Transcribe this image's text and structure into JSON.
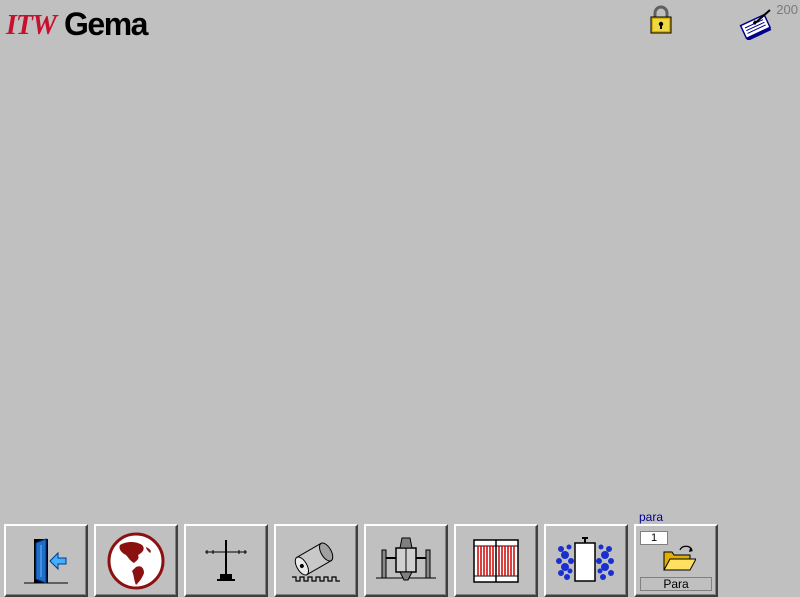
{
  "header": {
    "logo_itw": "ITW",
    "logo_gema": "Gema",
    "counter": "200"
  },
  "toolbar": {
    "para_caption": "para",
    "para_value": "1",
    "para_label": "Para",
    "buttons": [
      {
        "icon": "exit-door-icon"
      },
      {
        "icon": "globe-icon"
      },
      {
        "icon": "axis-icon"
      },
      {
        "icon": "roller-icon"
      },
      {
        "icon": "spray-booth-icon"
      },
      {
        "icon": "filter-grid-icon"
      },
      {
        "icon": "powder-cloud-icon"
      },
      {
        "icon": "folder-open-icon"
      }
    ]
  },
  "colors": {
    "background": "#c0c0c0",
    "logo_red": "#c8102e",
    "caption_blue": "#00008b",
    "globe_red": "#8b1010"
  }
}
